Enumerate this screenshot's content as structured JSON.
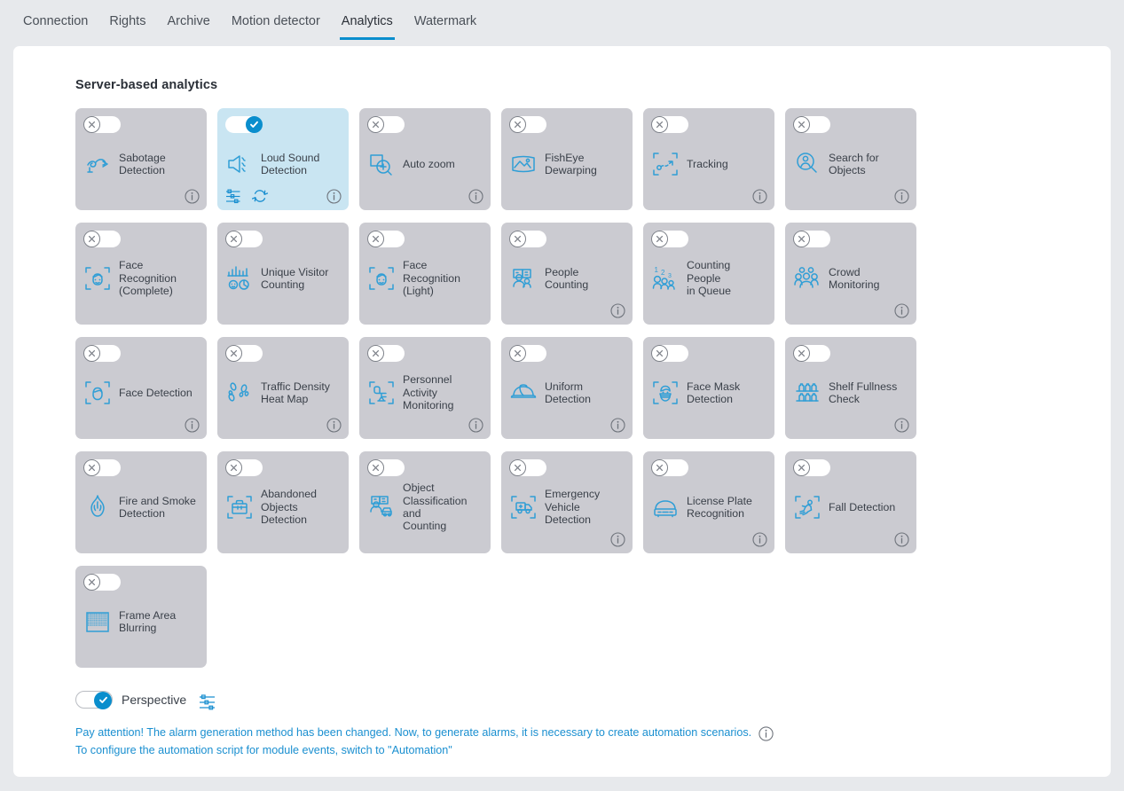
{
  "tabs": [
    {
      "label": "Connection",
      "active": false
    },
    {
      "label": "Rights",
      "active": false
    },
    {
      "label": "Archive",
      "active": false
    },
    {
      "label": "Motion detector",
      "active": false
    },
    {
      "label": "Analytics",
      "active": true
    },
    {
      "label": "Watermark",
      "active": false
    }
  ],
  "section": {
    "title": "Server-based analytics"
  },
  "colors": {
    "accent": "#0a8ecd",
    "card_off_bg": "#cbcbd1",
    "card_on_bg": "#c9e5f2",
    "page_bg": "#e7e9ec",
    "panel_bg": "#ffffff",
    "label_text": "#3a4049",
    "link_text": "#1a8fd0"
  },
  "cards": [
    {
      "id": "sabotage-detection",
      "label": "Sabotage\nDetection",
      "enabled": false,
      "icon": "sabotage-icon",
      "info": true,
      "settings": false,
      "refresh": false
    },
    {
      "id": "loud-sound-detection",
      "label": "Loud Sound\nDetection",
      "enabled": true,
      "icon": "loud-sound-icon",
      "info": true,
      "settings": true,
      "refresh": true
    },
    {
      "id": "auto-zoom",
      "label": "Auto zoom",
      "enabled": false,
      "icon": "auto-zoom-icon",
      "info": true,
      "settings": false,
      "refresh": false
    },
    {
      "id": "fisheye-dewarping",
      "label": "FishEye\nDewarping",
      "enabled": false,
      "icon": "fisheye-icon",
      "info": false,
      "settings": false,
      "refresh": false
    },
    {
      "id": "tracking",
      "label": "Tracking",
      "enabled": false,
      "icon": "tracking-icon",
      "info": true,
      "settings": false,
      "refresh": false
    },
    {
      "id": "search-for-objects",
      "label": "Search for\nObjects",
      "enabled": false,
      "icon": "search-objects-icon",
      "info": true,
      "settings": false,
      "refresh": false
    },
    {
      "id": "face-recognition-complete",
      "label": "Face Recognition\n(Complete)",
      "enabled": false,
      "icon": "face-recognition-icon",
      "info": false,
      "settings": false,
      "refresh": false
    },
    {
      "id": "unique-visitor-counting",
      "label": "Unique Visitor\nCounting",
      "enabled": false,
      "icon": "unique-visitor-icon",
      "info": false,
      "settings": false,
      "refresh": false
    },
    {
      "id": "face-recognition-light",
      "label": "Face Recognition\n(Light)",
      "enabled": false,
      "icon": "face-recognition-icon",
      "info": false,
      "settings": false,
      "refresh": false
    },
    {
      "id": "people-counting",
      "label": "People Counting",
      "enabled": false,
      "icon": "people-counting-icon",
      "info": true,
      "settings": false,
      "refresh": false
    },
    {
      "id": "counting-people-in-queue",
      "label": "Counting People\nin Queue",
      "enabled": false,
      "icon": "queue-counting-icon",
      "info": false,
      "settings": false,
      "refresh": false
    },
    {
      "id": "crowd-monitoring",
      "label": "Crowd\nMonitoring",
      "enabled": false,
      "icon": "crowd-icon",
      "info": true,
      "settings": false,
      "refresh": false
    },
    {
      "id": "face-detection",
      "label": "Face Detection",
      "enabled": false,
      "icon": "face-detection-icon",
      "info": true,
      "settings": false,
      "refresh": false
    },
    {
      "id": "traffic-density-heat-map",
      "label": "Traffic Density\nHeat Map",
      "enabled": false,
      "icon": "footprints-icon",
      "info": true,
      "settings": false,
      "refresh": false
    },
    {
      "id": "personnel-activity-monitoring",
      "label": "Personnel Activity\nMonitoring",
      "enabled": false,
      "icon": "office-chair-icon",
      "info": true,
      "settings": false,
      "refresh": false
    },
    {
      "id": "uniform-detection",
      "label": "Uniform\nDetection",
      "enabled": false,
      "icon": "helmet-icon",
      "info": true,
      "settings": false,
      "refresh": false
    },
    {
      "id": "face-mask-detection",
      "label": "Face Mask\nDetection",
      "enabled": false,
      "icon": "face-mask-icon",
      "info": false,
      "settings": false,
      "refresh": false
    },
    {
      "id": "shelf-fullness-check",
      "label": "Shelf Fullness\nCheck",
      "enabled": false,
      "icon": "shelf-icon",
      "info": true,
      "settings": false,
      "refresh": false
    },
    {
      "id": "fire-and-smoke-detection",
      "label": "Fire and Smoke\nDetection",
      "enabled": false,
      "icon": "flame-icon",
      "info": false,
      "settings": false,
      "refresh": false
    },
    {
      "id": "abandoned-objects-detection",
      "label": "Abandoned\nObjects\nDetection",
      "enabled": false,
      "icon": "briefcase-icon",
      "info": false,
      "settings": false,
      "refresh": false
    },
    {
      "id": "object-classification-and-counting",
      "label": "Object\nClassification and\nCounting",
      "enabled": false,
      "icon": "object-classification-icon",
      "info": false,
      "settings": false,
      "refresh": false
    },
    {
      "id": "emergency-vehicle-detection",
      "label": "Emergency\nVehicle Detection",
      "enabled": false,
      "icon": "ambulance-icon",
      "info": true,
      "settings": false,
      "refresh": false
    },
    {
      "id": "license-plate-recognition",
      "label": "License Plate\nRecognition",
      "enabled": false,
      "icon": "car-icon",
      "info": true,
      "settings": false,
      "refresh": false
    },
    {
      "id": "fall-detection",
      "label": "Fall Detection",
      "enabled": false,
      "icon": "fall-icon",
      "info": true,
      "settings": false,
      "refresh": false
    },
    {
      "id": "frame-area-blurring",
      "label": "Frame Area\nBlurring",
      "enabled": false,
      "icon": "blur-icon",
      "info": false,
      "settings": false,
      "refresh": false
    }
  ],
  "perspective": {
    "label": "Perspective",
    "enabled": true,
    "settings_icon": "sliders-icon"
  },
  "notice": {
    "line1": "Pay attention! The alarm generation method has been changed. Now, to generate alarms, it is necessary to create automation scenarios.",
    "line2": "To configure the automation script for module events, switch to \"Automation\"",
    "info_icon": "info-icon"
  }
}
